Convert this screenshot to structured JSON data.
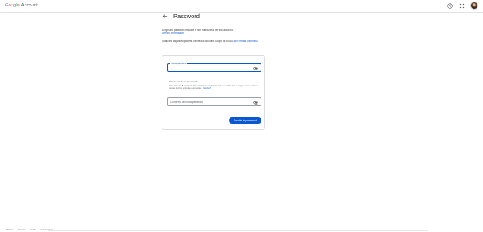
{
  "header": {
    "logo": {
      "g1": "G",
      "o1": "o",
      "o2": "o",
      "g2": "g",
      "l": "l",
      "e": "e",
      "product": "Account"
    },
    "icons": [
      "help-icon",
      "apps-grid-icon",
      "avatar"
    ]
  },
  "page": {
    "title": "Password"
  },
  "intro": {
    "p1": "Scegli una password efficace e non riutilizzarla per altri account.",
    "p1_link": "Ulteriori informazioni",
    "p2": "Su alcuni dispositivi potresti uscire dall'account. Scopri di più su",
    "p2_link": "dove rimani connesso"
  },
  "form": {
    "new_password_label": "Nuova password",
    "new_password_value": "",
    "strength_title": "Sicurezza della password:",
    "strength_text": "Usa almeno 8 caratteri. Non utilizzare una password di un altro sito o troppo ovvia, come il nome del tuo animale domestico.",
    "strength_link": "Perché?",
    "confirm_placeholder": "Conferma la nuova password",
    "confirm_value": "",
    "submit_label": "Cambia la password"
  },
  "footer": {
    "links": [
      "Privacy",
      "Termini",
      "Guida",
      "Informazioni"
    ]
  },
  "colors": {
    "accent": "#0b57d0",
    "border": "#dadce0",
    "text": "#202124"
  }
}
